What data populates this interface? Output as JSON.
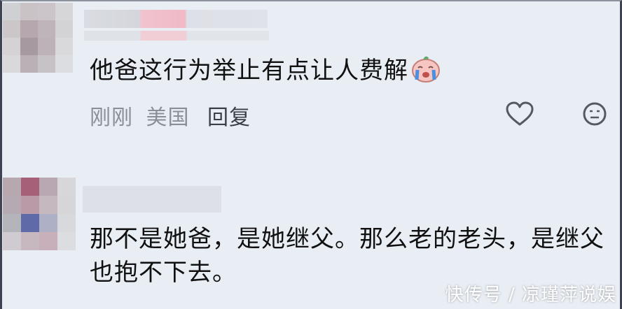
{
  "comments": [
    {
      "text": "他爸这行为举止有点让人费解",
      "time": "刚刚",
      "location": "美国",
      "reply_label": "回复",
      "emoji": "crying-face-emoji",
      "icons": {
        "like": "heart-icon",
        "react": "emoji-face-icon"
      }
    },
    {
      "text": "那不是她爸，是她继父。那么老的老头，是继父也抱不下去。"
    }
  ],
  "watermark": "快传号 / 凉瑾萍说娱",
  "colors": {
    "background": "#e9eef4",
    "text": "#111111",
    "meta": "#8a8f96",
    "reply": "#3a3f46"
  }
}
